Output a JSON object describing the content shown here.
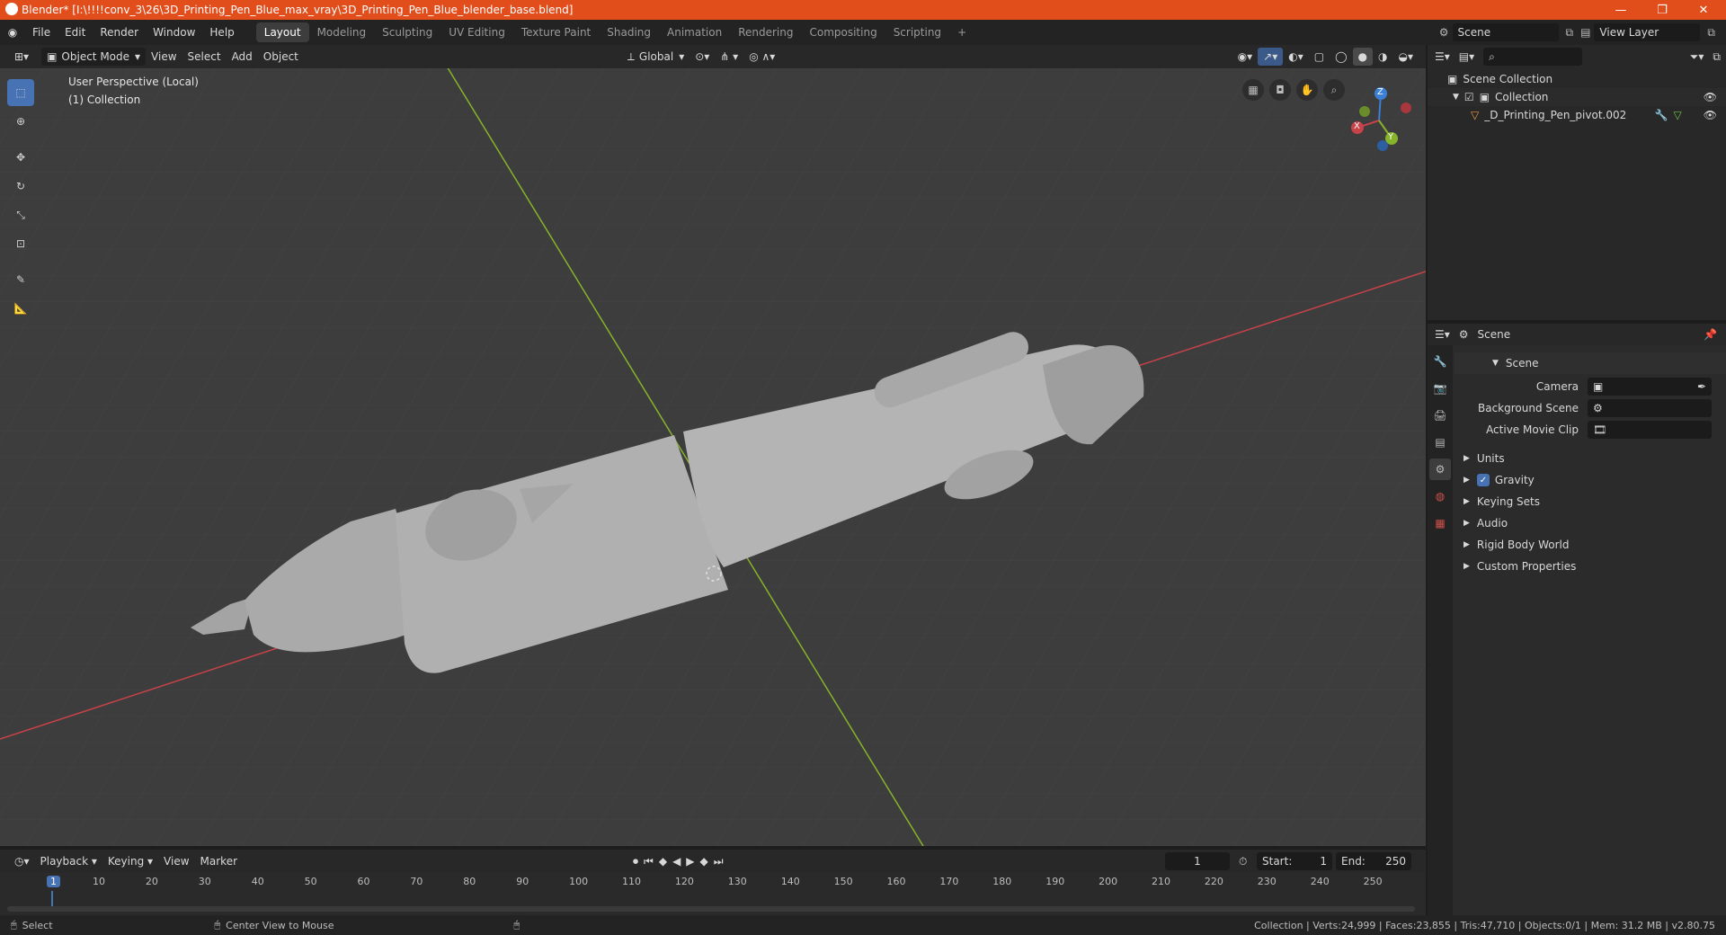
{
  "window": {
    "title": "Blender* [I:\\!!!!conv_3\\26\\3D_Printing_Pen_Blue_max_vray\\3D_Printing_Pen_Blue_blender_base.blend]",
    "minimize": "—",
    "maximize": "❐",
    "close": "✕"
  },
  "menu": {
    "items": [
      "File",
      "Edit",
      "Render",
      "Window",
      "Help"
    ]
  },
  "workspaces": {
    "tabs": [
      "Layout",
      "Modeling",
      "Sculpting",
      "UV Editing",
      "Texture Paint",
      "Shading",
      "Animation",
      "Rendering",
      "Compositing",
      "Scripting"
    ],
    "active": "Layout",
    "add": "+"
  },
  "scene_selector": {
    "value": "Scene"
  },
  "view_layer_selector": {
    "value": "View Layer"
  },
  "viewport_header": {
    "mode": "Object Mode",
    "menus": [
      "View",
      "Select",
      "Add",
      "Object"
    ],
    "orientation": "Global"
  },
  "viewport": {
    "perspective_label": "User Perspective (Local)",
    "collection_label": "(1) Collection",
    "gizmo": {
      "x": "X",
      "y": "Y",
      "z": "Z"
    }
  },
  "outliner": {
    "root": "Scene Collection",
    "collection": "Collection",
    "object": "_D_Printing_Pen_pivot.002"
  },
  "properties": {
    "header_title": "Scene",
    "panel_title": "Scene",
    "fields": [
      {
        "label": "Camera",
        "value": ""
      },
      {
        "label": "Background Scene",
        "value": ""
      },
      {
        "label": "Active Movie Clip",
        "value": ""
      }
    ],
    "sections": [
      "Units",
      "Gravity",
      "Keying Sets",
      "Audio",
      "Rigid Body World",
      "Custom Properties"
    ],
    "gravity_checked": true
  },
  "timeline": {
    "menus": [
      "Playback",
      "Keying",
      "View",
      "Marker"
    ],
    "current_frame": "1",
    "start_label": "Start:",
    "start": "1",
    "end_label": "End:",
    "end": "250",
    "ruler": [
      "1",
      "10",
      "20",
      "30",
      "40",
      "50",
      "60",
      "70",
      "80",
      "90",
      "100",
      "110",
      "120",
      "130",
      "140",
      "150",
      "160",
      "170",
      "180",
      "190",
      "200",
      "210",
      "220",
      "230",
      "240",
      "250"
    ]
  },
  "statusbar": {
    "select": "Select",
    "center_view": "Center View to Mouse",
    "stats": "Collection | Verts:24,999 | Faces:23,855 | Tris:47,710 | Objects:0/1 | Mem: 31.2 MB | v2.80.75"
  },
  "colors": {
    "title_bar": "#e24d1c",
    "active_tool": "#4772b3",
    "x_axis": "#c8424a",
    "y_axis": "#86b32a",
    "z_axis": "#3b7fd6"
  }
}
